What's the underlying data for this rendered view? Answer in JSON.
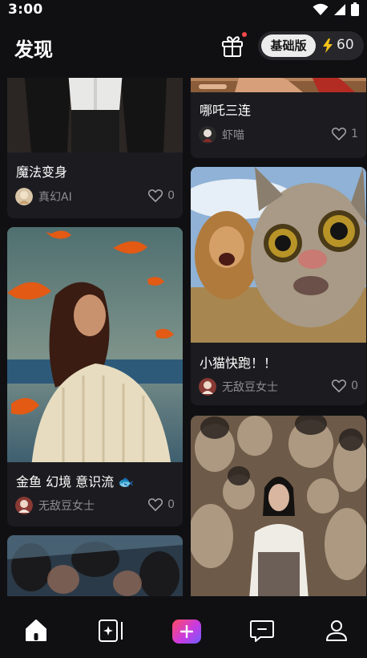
{
  "status_bar": {
    "time": "3:00",
    "icons": [
      "wifi-icon",
      "signal-icon",
      "battery-icon"
    ]
  },
  "header": {
    "title": "发现",
    "gift_icon": "gift-icon",
    "plan_badge": "基础版",
    "credit_icon": "lightning-icon",
    "credits": "60"
  },
  "feed": {
    "cards": [
      {
        "title": "哪吒三连",
        "author": "虾喵",
        "likes": "1"
      },
      {
        "title": "魔法变身",
        "author": "真幻AI",
        "likes": "0"
      },
      {
        "title": "小猫快跑！！",
        "author": "无敌豆女士",
        "likes": "0"
      },
      {
        "title": "金鱼 幻境 意识流 🐟",
        "author": "无敌豆女士",
        "likes": "0"
      },
      {
        "title": "",
        "author": "",
        "likes": ""
      },
      {
        "title": "",
        "author": "",
        "likes": ""
      }
    ]
  },
  "bottom_nav": {
    "items": [
      "home-icon",
      "template-icon",
      "create-icon",
      "message-icon",
      "profile-icon"
    ]
  },
  "colors": {
    "accent_gradient": [
      "#ff4b63",
      "#c93be0",
      "#6f5cff"
    ],
    "notification_dot": "#ff4a4a",
    "credit_bolt": "#f5c218"
  }
}
